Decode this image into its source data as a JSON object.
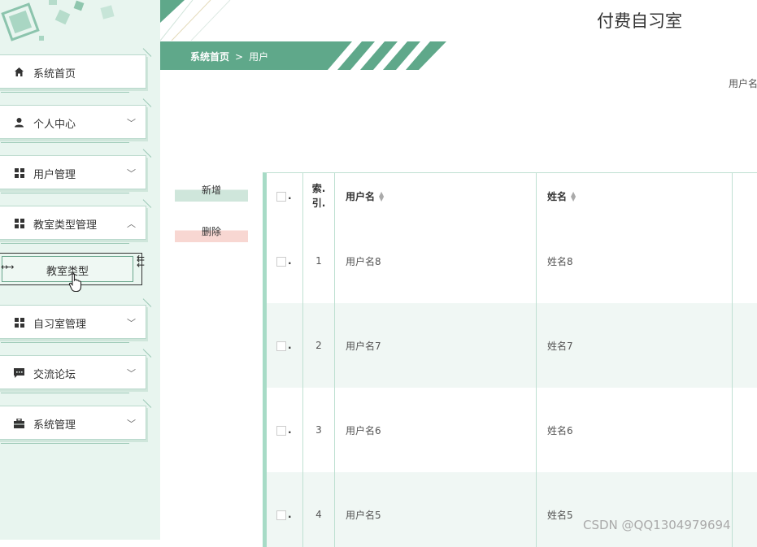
{
  "app": {
    "title": "付费自习室"
  },
  "breadcrumb": {
    "home": "系统首页",
    "separator": ">",
    "current": "用户"
  },
  "search": {
    "label": "用户名"
  },
  "sidebar": {
    "items": [
      {
        "label": "系统首页",
        "icon": "home-icon",
        "expandable": false
      },
      {
        "label": "个人中心",
        "icon": "user-icon",
        "expandable": true,
        "expanded": false
      },
      {
        "label": "用户管理",
        "icon": "grid-icon",
        "expandable": true,
        "expanded": false
      },
      {
        "label": "教室类型管理",
        "icon": "grid-icon",
        "expandable": true,
        "expanded": true
      },
      {
        "label": "自习室管理",
        "icon": "grid-icon",
        "expandable": true,
        "expanded": false
      },
      {
        "label": "交流论坛",
        "icon": "chat-icon",
        "expandable": true,
        "expanded": false
      },
      {
        "label": "系统管理",
        "icon": "briefcase-icon",
        "expandable": true,
        "expanded": false
      }
    ],
    "sub_item": {
      "label": "教室类型"
    }
  },
  "actions": {
    "add_label": "新增",
    "delete_label": "删除"
  },
  "table": {
    "headers": {
      "check": ".",
      "index_line1": "索.",
      "index_line2": "引.",
      "username": "用户名",
      "name": "姓名"
    },
    "rows": [
      {
        "index": "1",
        "username": "用户名8",
        "name": "姓名8"
      },
      {
        "index": "2",
        "username": "用户名7",
        "name": "姓名7"
      },
      {
        "index": "3",
        "username": "用户名6",
        "name": "姓名6"
      },
      {
        "index": "4",
        "username": "用户名5",
        "name": "姓名5"
      }
    ]
  },
  "watermark": "CSDN @QQ1304979694",
  "colors": {
    "accent": "#5fa88a",
    "sidebar_bg": "#e8f5ef",
    "table_border": "#bfe0d2",
    "add_btn": "#cfe6db",
    "delete_btn": "#f8d7d2"
  }
}
